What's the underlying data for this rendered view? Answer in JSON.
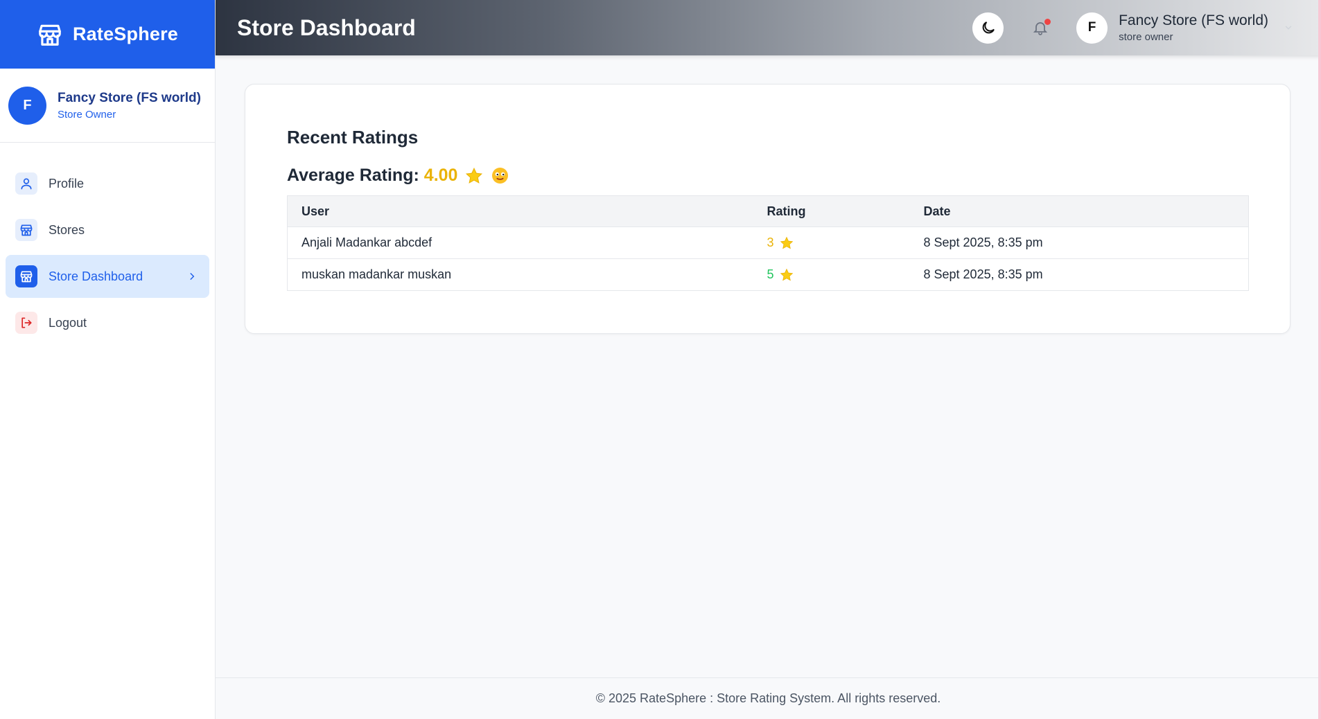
{
  "brand": {
    "name": "RateSphere",
    "icon": "store-icon"
  },
  "sidebar": {
    "user": {
      "initial": "F",
      "name": "Fancy Store (FS world)",
      "role": "Store Owner"
    },
    "items": [
      {
        "label": "Profile",
        "icon": "user-icon"
      },
      {
        "label": "Stores",
        "icon": "store-icon"
      },
      {
        "label": "Store Dashboard",
        "icon": "store-icon",
        "active": true
      },
      {
        "label": "Logout",
        "icon": "logout-icon"
      }
    ]
  },
  "header": {
    "title": "Store Dashboard",
    "user": {
      "initial": "F",
      "name": "Fancy Store (FS world)",
      "role": "store owner"
    }
  },
  "ratings": {
    "heading": "Recent Ratings",
    "average_label": "Average Rating:",
    "average_value": "4.00",
    "columns": [
      "User",
      "Rating",
      "Date"
    ],
    "rows": [
      {
        "user": "Anjali Madankar abcdef",
        "rating": "3",
        "date": "8 Sept 2025, 8:35 pm"
      },
      {
        "user": "muskan madankar muskan",
        "rating": "5",
        "date": "8 Sept 2025, 8:35 pm"
      }
    ]
  },
  "footer": {
    "text": "© 2025 RateSphere : Store Rating System. All rights reserved."
  },
  "colors": {
    "primary": "#1f5fea",
    "star": "#eab308",
    "good": "#22c55e",
    "alert": "#ef4444"
  }
}
